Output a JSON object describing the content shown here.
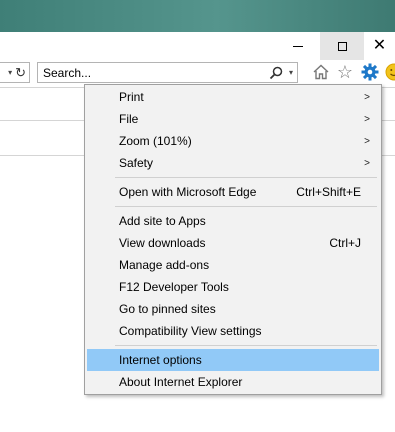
{
  "window": {
    "minimize_glyph": "",
    "close_glyph": "✕"
  },
  "address": {
    "dropdown_glyph": "▾",
    "refresh_glyph": "↻"
  },
  "search": {
    "placeholder": "Search...",
    "dropdown_glyph": "▾"
  },
  "toolbar": {
    "star_glyph": "☆"
  },
  "tools_menu": {
    "submenu_arrow": ">",
    "items": [
      {
        "label": "Print",
        "shortcut": "",
        "submenu": true
      },
      {
        "label": "File",
        "shortcut": "",
        "submenu": true
      },
      {
        "label": "Zoom (101%)",
        "shortcut": "",
        "submenu": true
      },
      {
        "label": "Safety",
        "shortcut": "",
        "submenu": true
      },
      {
        "label": "Open with Microsoft Edge",
        "shortcut": "Ctrl+Shift+E",
        "submenu": false
      },
      {
        "label": "Add site to Apps",
        "shortcut": "",
        "submenu": false
      },
      {
        "label": "View downloads",
        "shortcut": "Ctrl+J",
        "submenu": false
      },
      {
        "label": "Manage add-ons",
        "shortcut": "",
        "submenu": false
      },
      {
        "label": "F12 Developer Tools",
        "shortcut": "",
        "submenu": false
      },
      {
        "label": "Go to pinned sites",
        "shortcut": "",
        "submenu": false
      },
      {
        "label": "Compatibility View settings",
        "shortcut": "",
        "submenu": false
      },
      {
        "label": "Internet options",
        "shortcut": "",
        "submenu": false,
        "highlighted": true
      },
      {
        "label": "About Internet Explorer",
        "shortcut": "",
        "submenu": false
      }
    ]
  },
  "colors": {
    "titlebar": "#4a8a82",
    "menu_background": "#f2f2f2",
    "menu_highlight": "#91c9f7",
    "gear_icon": "#1e78c8",
    "smiley_icon": "#f2c31b"
  }
}
